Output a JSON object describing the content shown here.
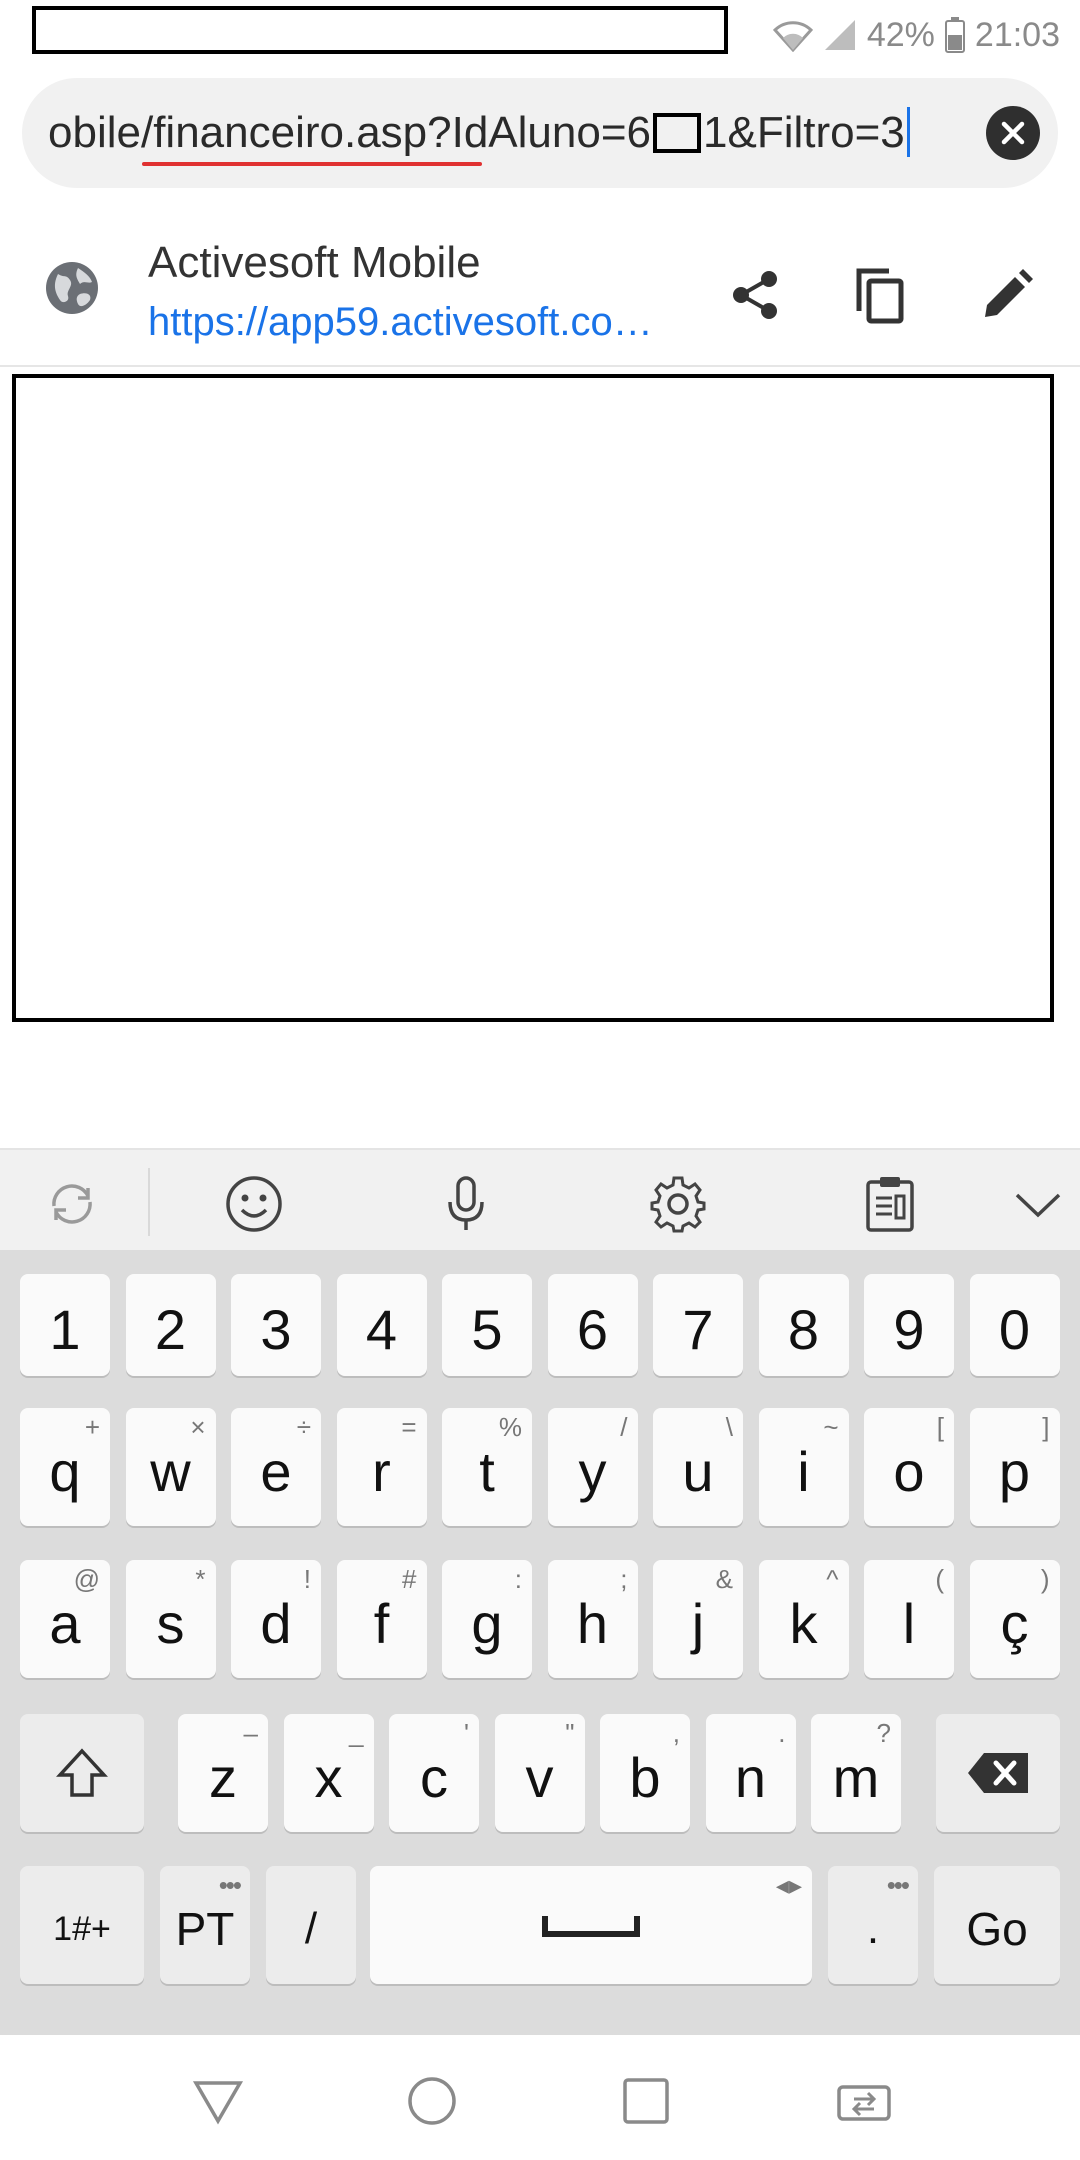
{
  "status_bar": {
    "battery": "42%",
    "time": "21:03"
  },
  "url_bar": {
    "url_prefix": "obile/financeiro.asp?IdAluno=6",
    "url_suffix": "1&Filtro=3"
  },
  "suggestion": {
    "title": "Activesoft Mobile",
    "url": "https://app59.activesoft.co…"
  },
  "keyboard": {
    "number_row": [
      "1",
      "2",
      "3",
      "4",
      "5",
      "6",
      "7",
      "8",
      "9",
      "0"
    ],
    "row1": [
      {
        "k": "q",
        "s": "+"
      },
      {
        "k": "w",
        "s": "×"
      },
      {
        "k": "e",
        "s": "÷"
      },
      {
        "k": "r",
        "s": "="
      },
      {
        "k": "t",
        "s": "%"
      },
      {
        "k": "y",
        "s": "/"
      },
      {
        "k": "u",
        "s": "\\"
      },
      {
        "k": "i",
        "s": "~"
      },
      {
        "k": "o",
        "s": "["
      },
      {
        "k": "p",
        "s": "]"
      }
    ],
    "row2": [
      {
        "k": "a",
        "s": "@"
      },
      {
        "k": "s",
        "s": "*"
      },
      {
        "k": "d",
        "s": "!"
      },
      {
        "k": "f",
        "s": "#"
      },
      {
        "k": "g",
        "s": ":"
      },
      {
        "k": "h",
        "s": ";"
      },
      {
        "k": "j",
        "s": "&"
      },
      {
        "k": "k",
        "s": "^"
      },
      {
        "k": "l",
        "s": "("
      },
      {
        "k": "ç",
        "s": ")"
      }
    ],
    "row3": [
      {
        "k": "z",
        "s": "–"
      },
      {
        "k": "x",
        "s": "_"
      },
      {
        "k": "c",
        "s": "'"
      },
      {
        "k": "v",
        "s": "\""
      },
      {
        "k": "b",
        "s": ","
      },
      {
        "k": "n",
        "s": "."
      },
      {
        "k": "m",
        "s": "?"
      }
    ],
    "bottom": {
      "symbols": "1#+",
      "lang": "PT",
      "slash": "/",
      "period": ".",
      "go": "Go"
    }
  }
}
